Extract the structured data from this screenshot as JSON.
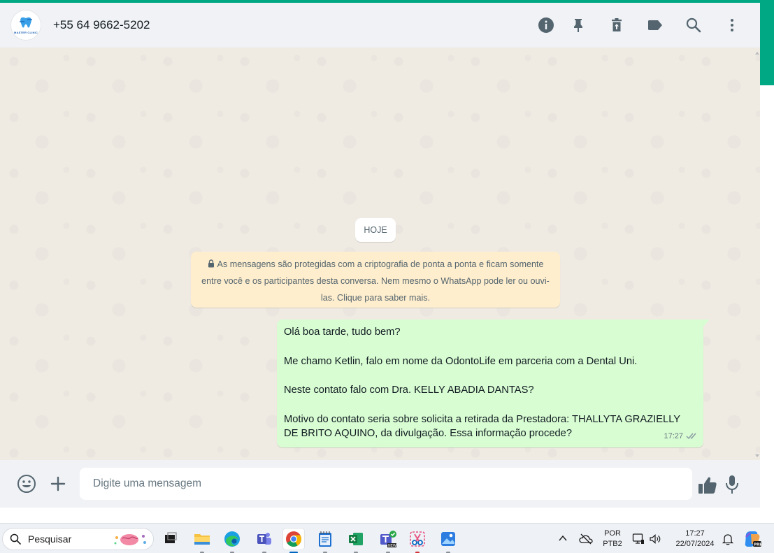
{
  "colors": {
    "accent": "#00a884",
    "outgoing_bubble": "#d9fdd3",
    "system_note": "#ffeecd",
    "chat_background": "#efeae2",
    "panel": "#f0f2f5"
  },
  "header": {
    "avatar_logo_text": "MASTER CLINIC",
    "contact_name": "+55 64 9662-5202",
    "icons": [
      "info-icon",
      "pin-icon",
      "delete-icon",
      "label-icon",
      "search-icon",
      "more-options-icon"
    ]
  },
  "chat": {
    "date_divider": "HOJE",
    "encryption_notice": "As mensagens são protegidas com a criptografia de ponta a ponta e ficam somente entre você e os participantes desta conversa. Nem mesmo o WhatsApp pode ler ou ouvi-las. Clique para saber mais.",
    "messages": [
      {
        "direction": "outgoing",
        "lines": [
          "Olá boa tarde, tudo bem?",
          "Me chamo Ketlin, falo em nome da OdontoLife em parceria com a Dental Uni.",
          "Neste contato falo com Dra. KELLY ABADIA DANTAS?",
          "Motivo do contato seria sobre solicita a retirada da Prestadora: THALLYTA GRAZIELLY DE BRITO AQUINO, da divulgação. Essa informação procede?"
        ],
        "time": "17:27",
        "status": "delivered"
      }
    ]
  },
  "composer": {
    "placeholder": "Digite uma mensagem",
    "icons": [
      "emoji-icon",
      "attach-icon",
      "like-icon",
      "microphone-icon"
    ]
  },
  "taskbar": {
    "search_placeholder": "Pesquisar",
    "apps": [
      "task-view",
      "file-explorer",
      "edge",
      "teams",
      "chrome",
      "notepad",
      "excel",
      "teams-new",
      "snipping-tool",
      "photos"
    ],
    "active_app": "chrome",
    "language": "POR",
    "keyboard_layout": "PTB2",
    "time": "17:27",
    "date": "22/07/2024"
  }
}
